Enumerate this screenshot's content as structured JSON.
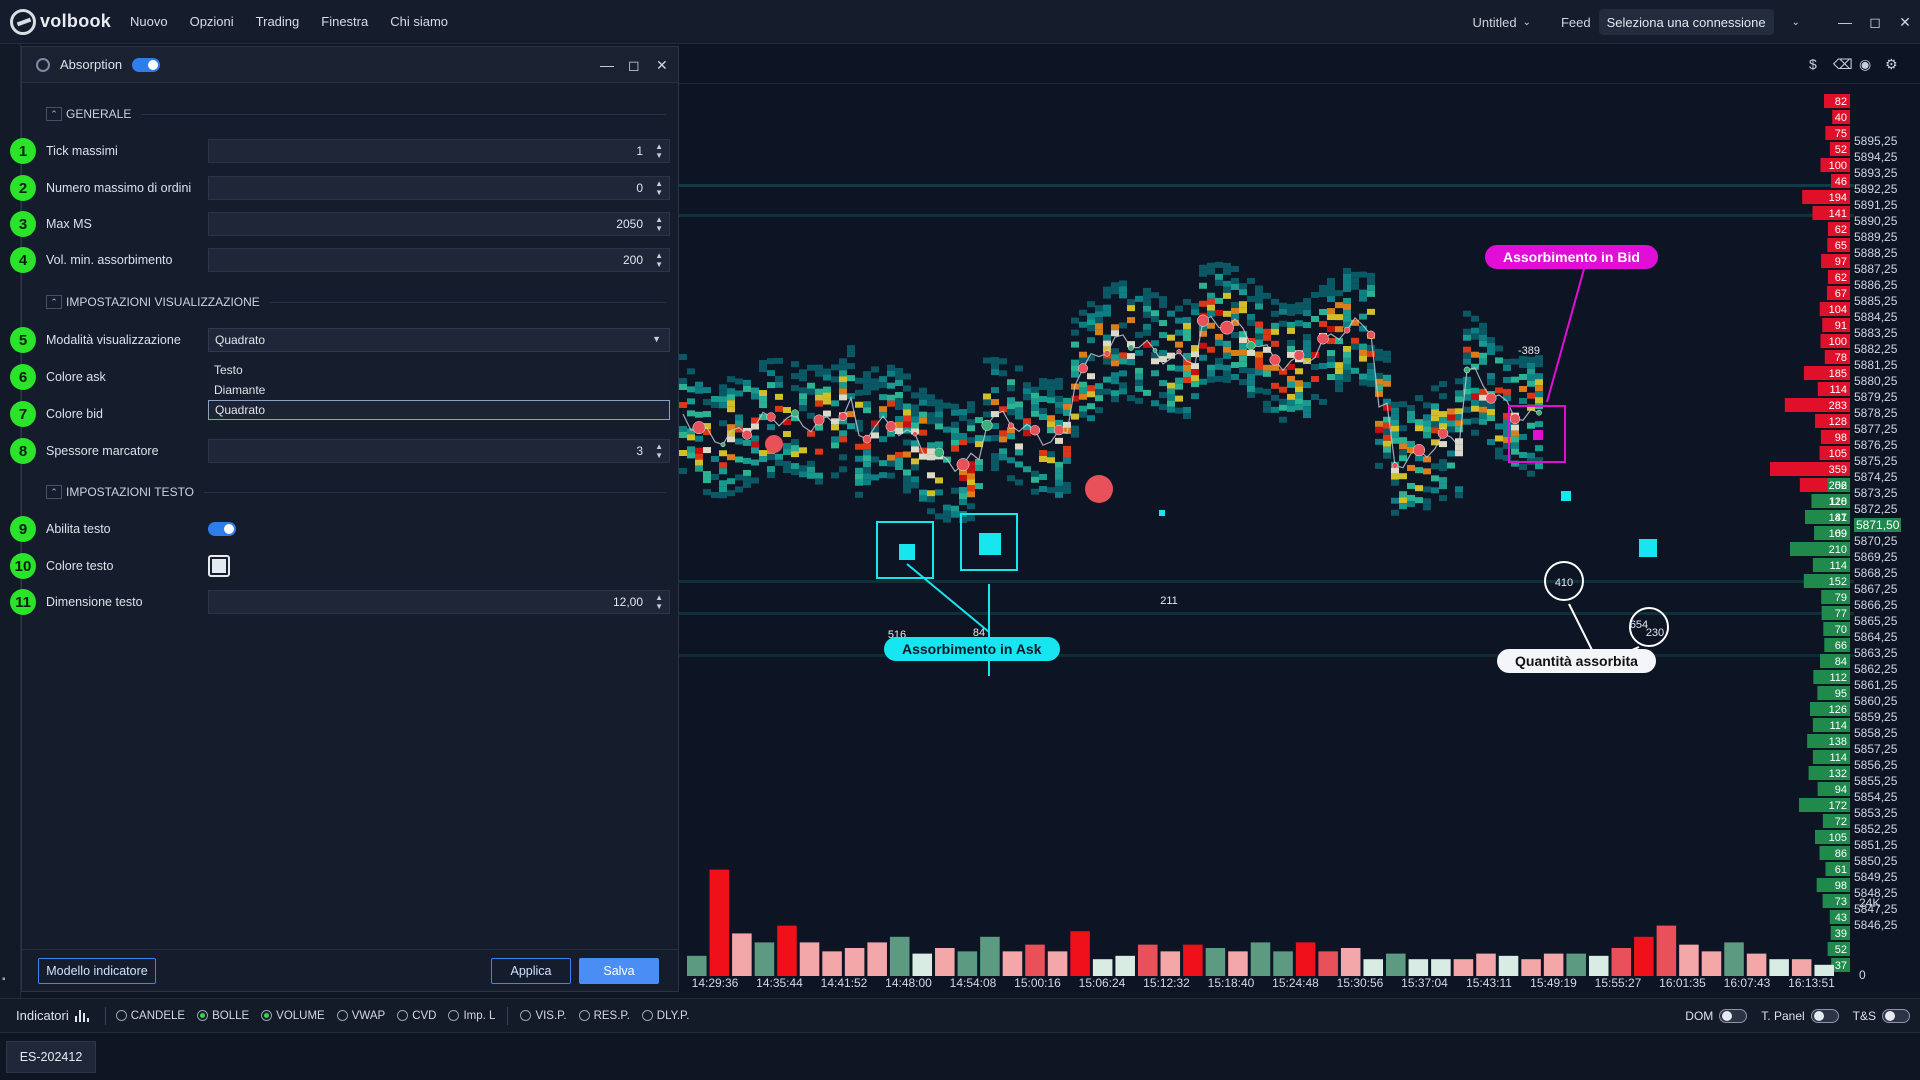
{
  "app": {
    "brand": "volbook",
    "menu": [
      "Nuovo",
      "Opzioni",
      "Trading",
      "Finestra",
      "Chi siamo"
    ],
    "doc_name": "Untitled",
    "feed_label": "Feed",
    "connection": "Seleziona una connessione"
  },
  "panel": {
    "title": "Absorption",
    "sections": {
      "general": "GENERALE",
      "display": "IMPOSTAZIONI VISUALIZZAZIONE",
      "text": "IMPOSTAZIONI TESTO"
    },
    "fields": {
      "tick": {
        "n": "1",
        "label": "Tick massimi",
        "value": "1"
      },
      "orders": {
        "n": "2",
        "label": "Numero massimo di ordini",
        "value": "0"
      },
      "maxms": {
        "n": "3",
        "label": "Max MS",
        "value": "2050"
      },
      "volmin": {
        "n": "4",
        "label": "Vol. min. assorbimento",
        "value": "200"
      },
      "mode": {
        "n": "5",
        "label": "Modalità visualizzazione",
        "value": "Quadrato",
        "options": [
          "Testo",
          "Diamante",
          "Quadrato"
        ]
      },
      "askcolor": {
        "n": "6",
        "label": "Colore ask"
      },
      "bidcolor": {
        "n": "7",
        "label": "Colore bid"
      },
      "thickness": {
        "n": "8",
        "label": "Spessore marcatore",
        "value": "3"
      },
      "textenable": {
        "n": "9",
        "label": "Abilita testo"
      },
      "textcolor": {
        "n": "10",
        "label": "Colore testo"
      },
      "textsize": {
        "n": "11",
        "label": "Dimensione testo",
        "value": "12,00"
      }
    },
    "buttons": {
      "template": "Modello indicatore",
      "apply": "Applica",
      "save": "Salva"
    }
  },
  "chart": {
    "annotations": {
      "bid": "Assorbimento in Bid",
      "ask": "Assorbimento in Ask",
      "qty": "Quantità assorbita"
    },
    "marker_labels": {
      "m389": "-389",
      "m516": "516",
      "m84": "84",
      "m211": "211",
      "m410": "410",
      "m654": "654",
      "m230": "230"
    },
    "current_price": "5871,50",
    "volume_scale": {
      "top": "24K",
      "bottom": "0"
    },
    "price_levels": [
      "5895,25",
      "5894,25",
      "5893,25",
      "5892,25",
      "5891,25",
      "5890,25",
      "5889,25",
      "5888,25",
      "5887,25",
      "5886,25",
      "5885,25",
      "5884,25",
      "5883,25",
      "5882,25",
      "5881,25",
      "5880,25",
      "5879,25",
      "5878,25",
      "5877,25",
      "5876,25",
      "5875,25",
      "5874,25",
      "5873,25",
      "5872,25",
      "5871,50",
      "5870,25",
      "5869,25",
      "5868,25",
      "5867,25",
      "5866,25",
      "5865,25",
      "5864,25",
      "5863,25",
      "5862,25",
      "5861,25",
      "5860,25",
      "5859,25",
      "5858,25",
      "5857,25",
      "5856,25",
      "5855,25",
      "5854,25",
      "5853,25",
      "5852,25",
      "5851,25",
      "5850,25",
      "5849,25",
      "5848,25",
      "5847,25",
      "5846,25"
    ],
    "dom_ask": [
      "82",
      "40",
      "75",
      "52",
      "100",
      "46",
      "194",
      "141",
      "62",
      "65",
      "97",
      "62",
      "67",
      "104",
      "91",
      "100",
      "78",
      "185",
      "114",
      "283",
      "128",
      "98",
      "105",
      "359",
      "206",
      "118",
      "81",
      "69"
    ],
    "dom_bid": [
      "52",
      "120",
      "147",
      "109",
      "210",
      "114",
      "152",
      "79",
      "77",
      "70",
      "66",
      "84",
      "112",
      "95",
      "126",
      "114",
      "138",
      "114",
      "132",
      "94",
      "172",
      "72",
      "105",
      "86",
      "61",
      "98",
      "73",
      "43",
      "39",
      "52",
      "37"
    ],
    "time_labels": [
      "14:29:36",
      "14:35:44",
      "14:41:52",
      "14:48:00",
      "14:54:08",
      "15:00:16",
      "15:06:24",
      "15:12:32",
      "15:18:40",
      "15:24:48",
      "15:30:56",
      "15:37:04",
      "15:43:11",
      "15:49:19",
      "15:55:27",
      "16:01:35",
      "16:07:43",
      "16:13:51"
    ],
    "volume_bars": [
      {
        "v": 0.18,
        "c": "#5c9b82"
      },
      {
        "v": 0.95,
        "c": "#f0101a"
      },
      {
        "v": 0.38,
        "c": "#f3a7a9"
      },
      {
        "v": 0.3,
        "c": "#5c9b82"
      },
      {
        "v": 0.45,
        "c": "#f0101a"
      },
      {
        "v": 0.3,
        "c": "#f3a7a9"
      },
      {
        "v": 0.22,
        "c": "#f3a7a9"
      },
      {
        "v": 0.25,
        "c": "#f3a7a9"
      },
      {
        "v": 0.3,
        "c": "#f3a7a9"
      },
      {
        "v": 0.35,
        "c": "#5c9b82"
      },
      {
        "v": 0.2,
        "c": "#d9ece4"
      },
      {
        "v": 0.25,
        "c": "#f3a7a9"
      },
      {
        "v": 0.22,
        "c": "#5c9b82"
      },
      {
        "v": 0.35,
        "c": "#5c9b82"
      },
      {
        "v": 0.22,
        "c": "#f3a7a9"
      },
      {
        "v": 0.28,
        "c": "#e8505a"
      },
      {
        "v": 0.22,
        "c": "#f3a7a9"
      },
      {
        "v": 0.4,
        "c": "#f0101a"
      },
      {
        "v": 0.15,
        "c": "#d9ece4"
      },
      {
        "v": 0.18,
        "c": "#d9ece4"
      },
      {
        "v": 0.28,
        "c": "#e8505a"
      },
      {
        "v": 0.22,
        "c": "#f3a7a9"
      },
      {
        "v": 0.28,
        "c": "#f0101a"
      },
      {
        "v": 0.25,
        "c": "#5c9b82"
      },
      {
        "v": 0.22,
        "c": "#f3a7a9"
      },
      {
        "v": 0.3,
        "c": "#5c9b82"
      },
      {
        "v": 0.22,
        "c": "#5c9b82"
      },
      {
        "v": 0.3,
        "c": "#f0101a"
      },
      {
        "v": 0.22,
        "c": "#e8505a"
      },
      {
        "v": 0.25,
        "c": "#f3a7a9"
      },
      {
        "v": 0.15,
        "c": "#d9ece4"
      },
      {
        "v": 0.2,
        "c": "#5c9b82"
      },
      {
        "v": 0.15,
        "c": "#d9ece4"
      },
      {
        "v": 0.15,
        "c": "#d9ece4"
      },
      {
        "v": 0.15,
        "c": "#f3a7a9"
      },
      {
        "v": 0.2,
        "c": "#f3a7a9"
      },
      {
        "v": 0.18,
        "c": "#d9ece4"
      },
      {
        "v": 0.15,
        "c": "#f3a7a9"
      },
      {
        "v": 0.2,
        "c": "#f3a7a9"
      },
      {
        "v": 0.2,
        "c": "#5c9b82"
      },
      {
        "v": 0.18,
        "c": "#d9ece4"
      },
      {
        "v": 0.25,
        "c": "#e8505a"
      },
      {
        "v": 0.35,
        "c": "#f0101a"
      },
      {
        "v": 0.45,
        "c": "#e8505a"
      },
      {
        "v": 0.28,
        "c": "#f3a7a9"
      },
      {
        "v": 0.22,
        "c": "#f3a7a9"
      },
      {
        "v": 0.3,
        "c": "#5c9b82"
      },
      {
        "v": 0.2,
        "c": "#f3a7a9"
      },
      {
        "v": 0.15,
        "c": "#d9ece4"
      },
      {
        "v": 0.15,
        "c": "#f3a7a9"
      },
      {
        "v": 0.1,
        "c": "#d9ece4"
      }
    ]
  },
  "bottom": {
    "indicators_label": "Indicatori",
    "radios": [
      {
        "label": "CANDELE",
        "on": false
      },
      {
        "label": "BOLLE",
        "on": true
      },
      {
        "label": "VOLUME",
        "on": true
      },
      {
        "label": "VWAP",
        "on": false
      },
      {
        "label": "CVD",
        "on": false
      },
      {
        "label": "Imp. L",
        "on": false
      },
      {
        "label": "VIS.P.",
        "on": false
      },
      {
        "label": "RES.P.",
        "on": false
      },
      {
        "label": "DLY.P.",
        "on": false
      }
    ],
    "toggles": {
      "dom": "DOM",
      "tpanel": "T. Panel",
      "ts": "T&S"
    },
    "symbol": "ES-202412"
  }
}
